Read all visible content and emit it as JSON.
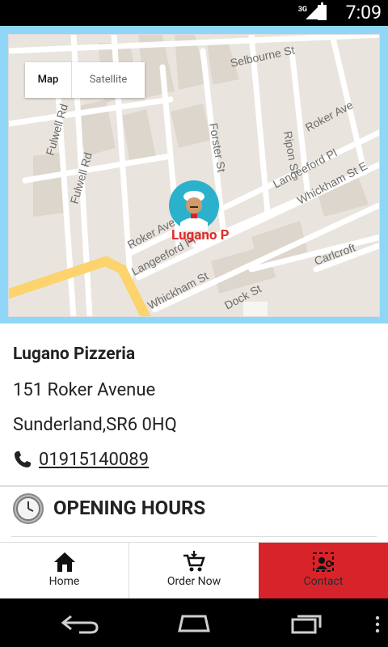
{
  "status_bar": {
    "signal": "3G",
    "time": "7:09"
  },
  "map": {
    "toggle": [
      "Map",
      "Satellite"
    ],
    "marker_label": "Lugano P",
    "streets": [
      "Selbourne St",
      "Ripon St",
      "Roker Ave",
      "Fulwell Rd",
      "Fulwell Rd",
      "Forster St",
      "Langeeford Pl",
      "Whickham St E",
      "Roker Ave",
      "Langeeford Pl",
      "Carlcroft",
      "Whickham St",
      "Dock St"
    ]
  },
  "info": {
    "name": "Lugano Pizzeria",
    "address_line1": "151 Roker Avenue",
    "address_line2": "Sunderland,SR6 0HQ",
    "phone": "01915140089"
  },
  "hours": {
    "title": "OPENING HOURS"
  },
  "tabs": [
    {
      "label": "Home"
    },
    {
      "label": "Order Now"
    },
    {
      "label": "Contact"
    }
  ],
  "colors": {
    "accent": "#d9232a",
    "marker": "#2cb1cc",
    "map_frame": "#8fd6f7"
  }
}
